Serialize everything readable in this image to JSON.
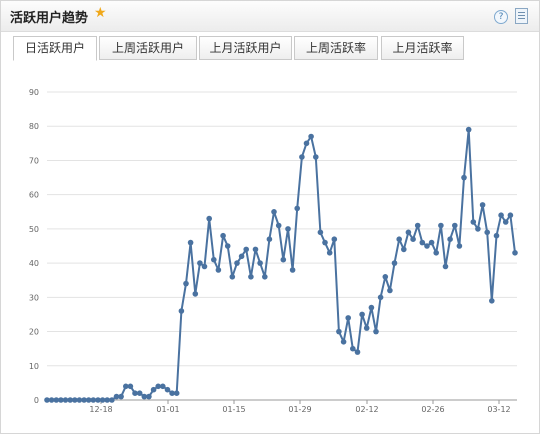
{
  "header": {
    "title": "活跃用户趋势",
    "star_icon": "star-icon",
    "help_icon": "help-icon",
    "export_icon": "export-icon"
  },
  "tabs": [
    {
      "label": "日活跃用户",
      "active": true
    },
    {
      "label": "上周活跃用户",
      "active": false
    },
    {
      "label": "上月活跃用户",
      "active": false
    },
    {
      "label": "上周活跃率",
      "active": false
    },
    {
      "label": "上月活跃率",
      "active": false
    }
  ],
  "chart_data": {
    "type": "line",
    "ylim": [
      0,
      90
    ],
    "yticks": [
      0,
      10,
      20,
      30,
      40,
      50,
      60,
      70,
      80,
      90
    ],
    "xtick_labels": [
      "12-18",
      "01-01",
      "01-15",
      "01-29",
      "02-12",
      "02-26",
      "03-12"
    ],
    "line_color": "#4a72a0",
    "values": [
      0,
      0,
      0,
      0,
      0,
      0,
      0,
      0,
      0,
      0,
      0,
      0,
      0,
      0,
      0,
      1,
      1,
      4,
      4,
      2,
      2,
      1,
      1,
      3,
      4,
      4,
      3,
      2,
      2,
      26,
      34,
      46,
      31,
      40,
      39,
      53,
      41,
      38,
      48,
      45,
      36,
      40,
      42,
      44,
      36,
      44,
      40,
      36,
      47,
      55,
      51,
      41,
      50,
      38,
      56,
      71,
      75,
      77,
      71,
      49,
      46,
      43,
      47,
      20,
      17,
      24,
      15,
      14,
      25,
      21,
      27,
      20,
      30,
      36,
      32,
      40,
      47,
      44,
      49,
      47,
      51,
      46,
      45,
      46,
      43,
      51,
      39,
      47,
      51,
      45,
      65,
      79,
      52,
      50,
      57,
      49,
      29,
      48,
      54,
      52,
      54,
      43
    ]
  }
}
